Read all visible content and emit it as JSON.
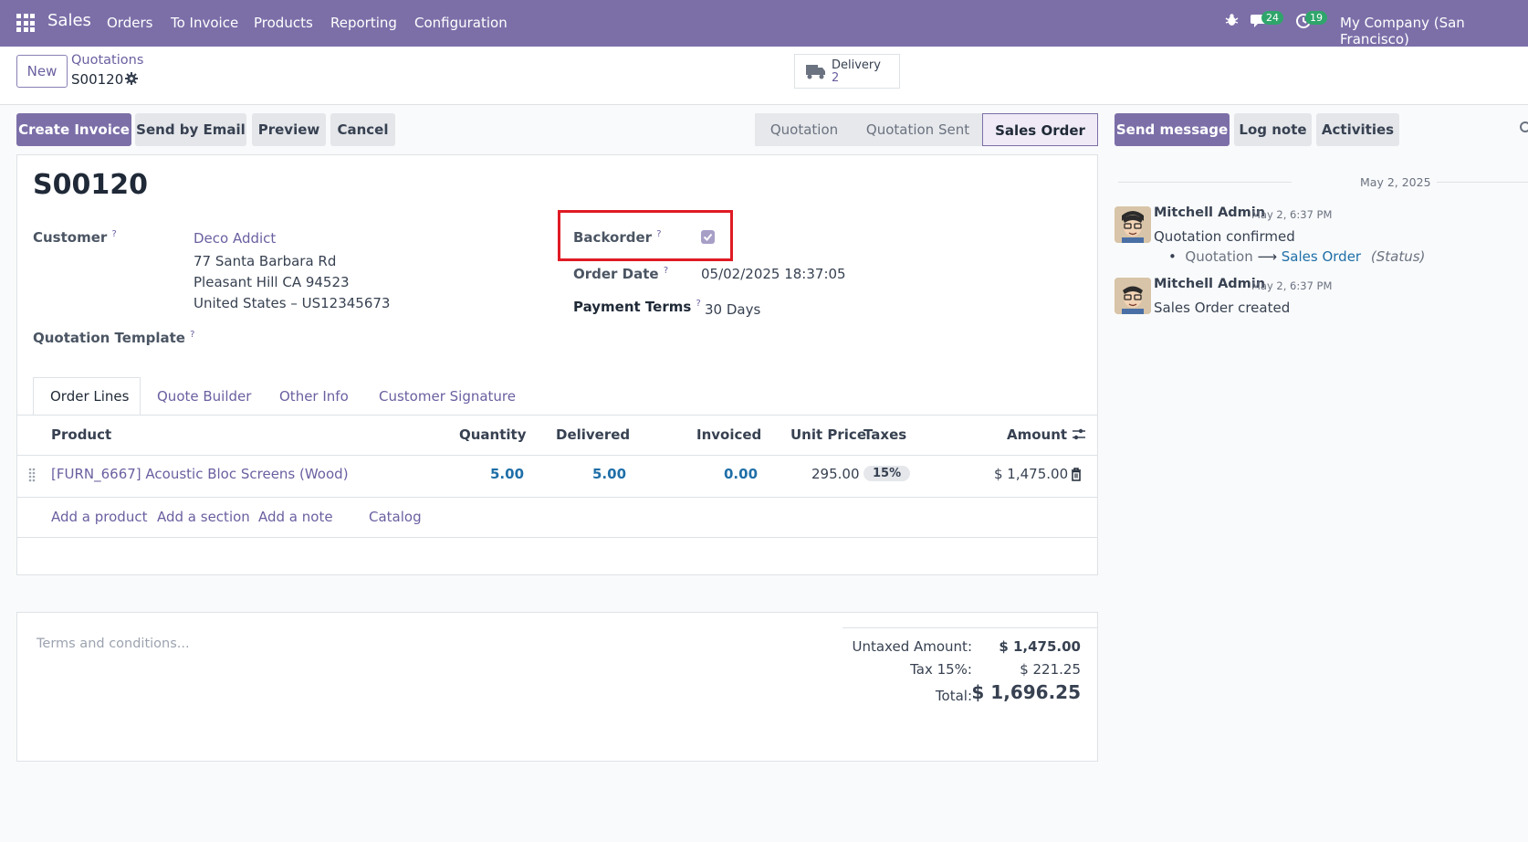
{
  "nav": {
    "app": "Sales",
    "menu": [
      "Orders",
      "To Invoice",
      "Products",
      "Reporting",
      "Configuration"
    ],
    "messages_count": "24",
    "activities_count": "19",
    "company": "My Company (San Francisco)"
  },
  "control": {
    "new_label": "New",
    "breadcrumb_parent": "Quotations",
    "record_name": "S00120",
    "smart_delivery_label": "Delivery",
    "smart_delivery_count": "2"
  },
  "actions": {
    "create_invoice": "Create Invoice",
    "send_email": "Send by Email",
    "preview": "Preview",
    "cancel": "Cancel"
  },
  "statusbar": [
    "Quotation",
    "Quotation Sent",
    "Sales Order"
  ],
  "status_active": "Sales Order",
  "chatter_buttons": {
    "send_message": "Send message",
    "log_note": "Log note",
    "activities": "Activities"
  },
  "form": {
    "title": "S00120",
    "customer_label": "Customer",
    "customer_name": "Deco Addict",
    "address_1": "77 Santa Barbara Rd",
    "address_2": "Pleasant Hill CA 94523",
    "address_3": "United States – US12345673",
    "template_label": "Quotation Template",
    "backorder_label": "Backorder",
    "backorder_checked": true,
    "order_date_label": "Order Date",
    "order_date": "05/02/2025 18:37:05",
    "payment_terms_label": "Payment Terms",
    "payment_terms": "30 Days"
  },
  "tabs": [
    "Order Lines",
    "Quote Builder",
    "Other Info",
    "Customer Signature"
  ],
  "table": {
    "headers": [
      "Product",
      "Quantity",
      "Delivered",
      "Invoiced",
      "Unit Price",
      "Taxes",
      "Amount"
    ],
    "rows": [
      {
        "product": "[FURN_6667] Acoustic Bloc Screens (Wood)",
        "quantity": "5.00",
        "delivered": "5.00",
        "invoiced": "0.00",
        "unit_price": "295.00",
        "taxes": "15%",
        "amount": "$ 1,475.00"
      }
    ],
    "add_product": "Add a product",
    "add_section": "Add a section",
    "add_note": "Add a note",
    "catalog": "Catalog"
  },
  "terms_placeholder": "Terms and conditions...",
  "totals": {
    "untaxed_label": "Untaxed Amount:",
    "untaxed": "$ 1,475.00",
    "tax_label": "Tax 15%:",
    "tax": "$ 221.25",
    "total_label": "Total:",
    "total": "$ 1,696.25"
  },
  "chatter": {
    "date_separator": "May 2, 2025",
    "messages": [
      {
        "author": "Mitchell Admin",
        "time": "May 2, 6:37 PM",
        "text": "Quotation confirmed",
        "tracking_old": "Quotation",
        "tracking_new": "Sales Order",
        "tracking_field": "(Status)"
      },
      {
        "author": "Mitchell Admin",
        "time": "May 2, 6:37 PM",
        "text": "Sales Order created"
      }
    ]
  },
  "colors": {
    "brand": "#7c6fa8",
    "highlight": "#e01b24",
    "link_blue": "#1f6fa8"
  }
}
